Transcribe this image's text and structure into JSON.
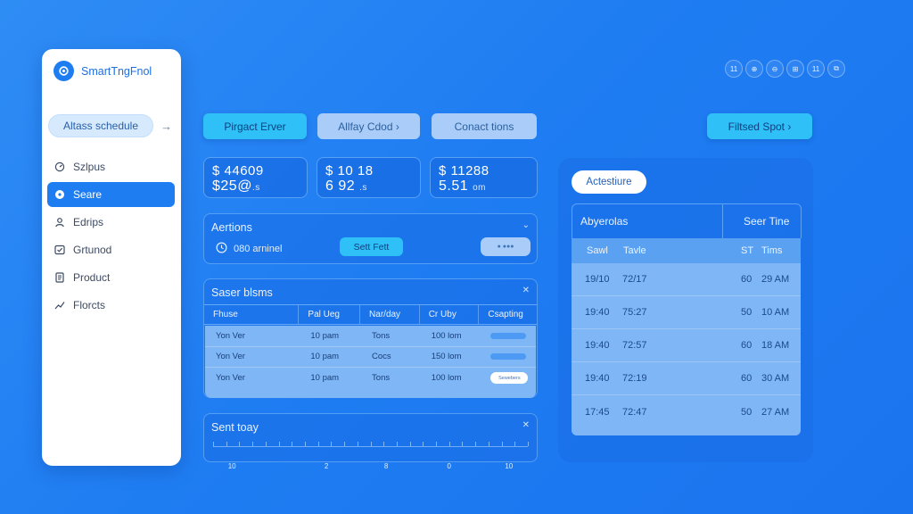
{
  "app": {
    "name": "SmartTngFnol",
    "schedule_button": "Altass schedule"
  },
  "sidebar": {
    "items": [
      {
        "label": "Szlpus",
        "icon": "gauge-icon",
        "active": false
      },
      {
        "label": "Seare",
        "icon": "settings-icon",
        "active": true
      },
      {
        "label": "Edrips",
        "icon": "user-icon",
        "active": false
      },
      {
        "label": "Grtunod",
        "icon": "check-box-icon",
        "active": false
      },
      {
        "label": "Product",
        "icon": "document-icon",
        "active": false
      },
      {
        "label": "Florcts",
        "icon": "trend-icon",
        "active": false
      }
    ]
  },
  "window_controls": [
    "11",
    "⊕",
    "⊖",
    "⊞",
    "11",
    "⧉"
  ],
  "top_buttons": {
    "b1": "Pirgact Erver",
    "b2": "Allfay Cdod ›",
    "b3": "Conact tions",
    "b4": "Filtsed Spot ›"
  },
  "stats": [
    {
      "line1": "$ 44609",
      "line2": "$25@",
      "unit": ".s"
    },
    {
      "line1": "$ 10 18",
      "line2": "6 92",
      "unit": ".s"
    },
    {
      "line1": "$ 11288",
      "line2": "5.51",
      "unit": "om"
    }
  ],
  "aertions": {
    "title": "Aertions",
    "chevron": "⌄",
    "alarm_text": "080 arninel",
    "set_button": "Sett Fett",
    "pill": "● ●●●"
  },
  "saser_table": {
    "title": "Saser blsms",
    "close": "✕",
    "columns": [
      "Fhuse",
      "Pal Ueg",
      "Nar/day",
      "Cr Uby",
      "Csapting"
    ],
    "rows": [
      {
        "c1": "Yon Ver",
        "c2": "10 pam",
        "c3": "Tons",
        "c4": "100 lom"
      },
      {
        "c1": "Yon Ver",
        "c2": "10 pam",
        "c3": "Cocs",
        "c4": "150 lom"
      },
      {
        "c1": "Yon Ver",
        "c2": "10 pam",
        "c3": "Tons",
        "c4": "100 lom"
      }
    ],
    "row_button": "Sewebers"
  },
  "timeline": {
    "title": "Sent toay",
    "close": "✕",
    "labels": [
      "10",
      "2",
      "8",
      "0",
      "10"
    ]
  },
  "right_panel": {
    "chip": "Actestiure",
    "head_left": "Abyerolas",
    "head_right": "Seer Tine",
    "table_header": {
      "c1": "Sawl",
      "c2": "Tavle",
      "c3": "ST",
      "c4": "Tims"
    },
    "rows": [
      {
        "c1": "19/10",
        "c2": "72/17",
        "c3": "60",
        "c4": "29 AM"
      },
      {
        "c1": "19:40",
        "c2": "75:27",
        "c3": "50",
        "c4": "10 AM"
      },
      {
        "c1": "19:40",
        "c2": "72:57",
        "c3": "60",
        "c4": "18 AM"
      },
      {
        "c1": "19:40",
        "c2": "72:19",
        "c3": "60",
        "c4": "30 AM"
      },
      {
        "c1": "17:45",
        "c2": "72:47",
        "c3": "50",
        "c4": "27 AM"
      }
    ]
  },
  "colors": {
    "background": "#1f7df2",
    "accent_cyan": "#2ec0f7",
    "soft_button": "#a9cdf8",
    "table_fill": "#7fb6f5"
  }
}
